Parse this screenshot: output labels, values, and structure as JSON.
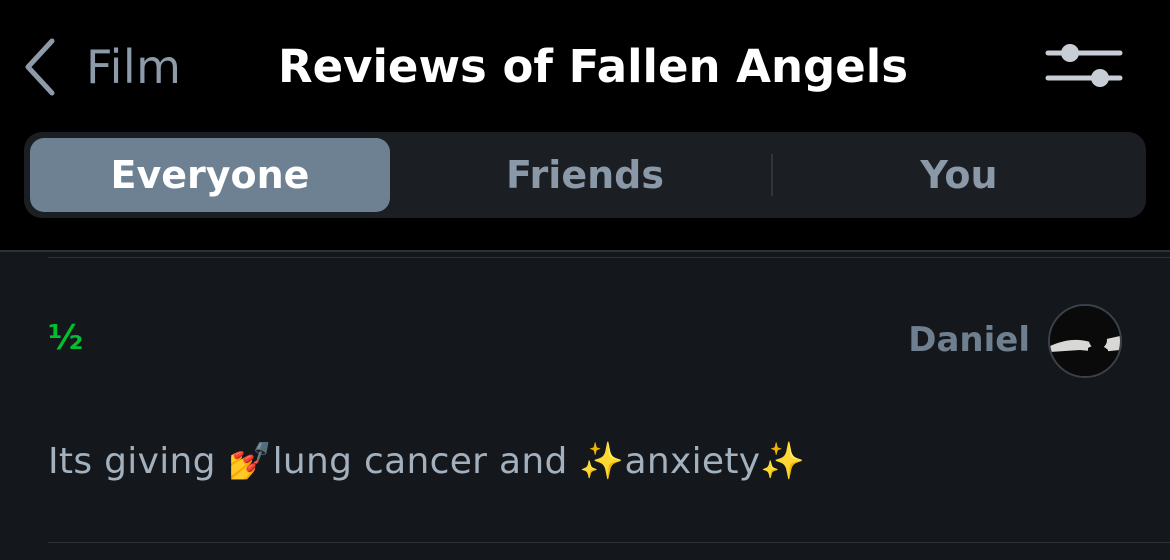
{
  "nav": {
    "back_label": "Film",
    "title": "Reviews of Fallen Angels"
  },
  "tabs": [
    {
      "label": "Everyone",
      "active": true
    },
    {
      "label": "Friends",
      "active": false
    },
    {
      "label": "You",
      "active": false
    }
  ],
  "review": {
    "rating": "½",
    "author": "Daniel",
    "text": "Its giving 💅lung cancer and ✨anxiety✨"
  },
  "colors": {
    "rating_green": "#00c030",
    "active_tab": "#6e8193",
    "background": "#14181c"
  },
  "icons": {
    "back": "chevron-left-icon",
    "filter": "sliders-icon"
  }
}
